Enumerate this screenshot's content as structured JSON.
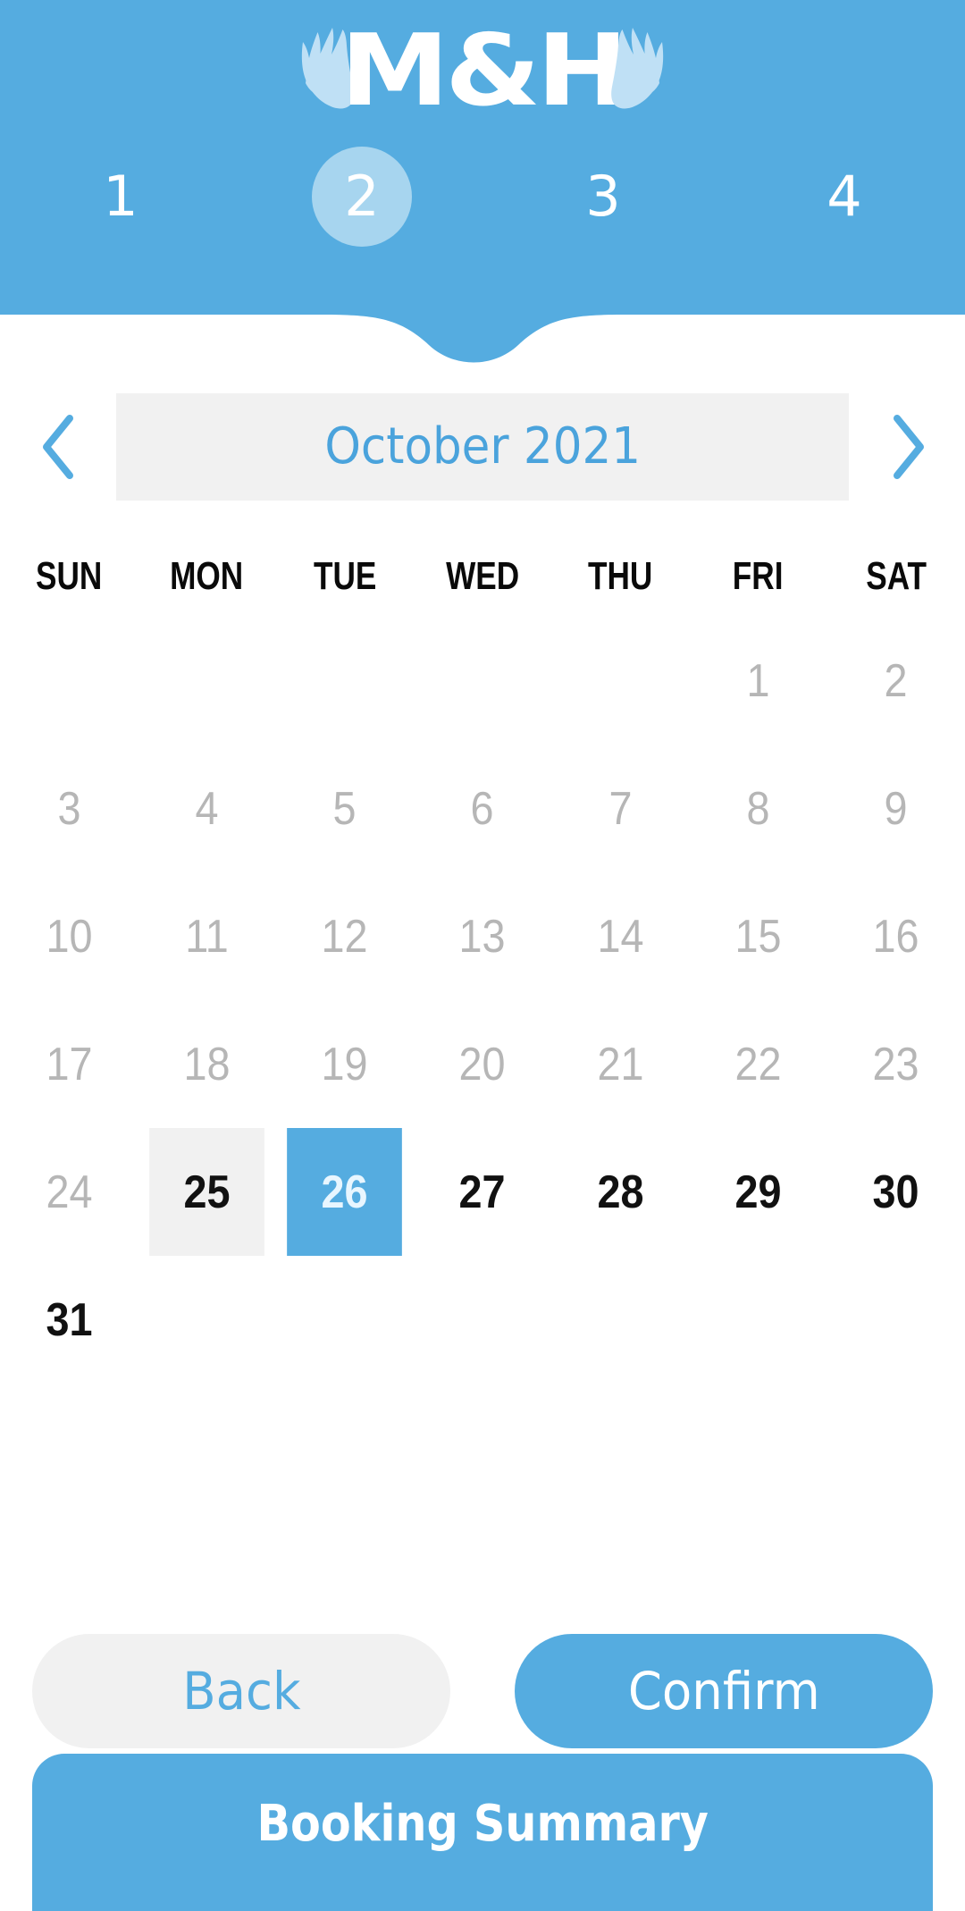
{
  "brand": {
    "name": "M&H",
    "left_wing_icon": "wing-icon",
    "right_wing_icon": "wing-icon",
    "header_color": "#55ace0",
    "accent_color": "#55ace0",
    "step_circle_color": "#a7d5ef"
  },
  "stepper": {
    "active_step": "2",
    "steps": [
      {
        "label": "1",
        "active": false
      },
      {
        "label": "2",
        "active": true
      },
      {
        "label": "3",
        "active": false
      },
      {
        "label": "4",
        "active": false
      }
    ]
  },
  "month_nav": {
    "prev_icon": "chevron-left-icon",
    "next_icon": "chevron-right-icon",
    "label": "October 2021"
  },
  "calendar": {
    "weekdays": [
      "SUN",
      "MON",
      "TUE",
      "WED",
      "THU",
      "FRI",
      "SAT"
    ],
    "selected_day": "26",
    "today": "25",
    "weeks": [
      [
        {
          "label": "",
          "state": "empty"
        },
        {
          "label": "",
          "state": "empty"
        },
        {
          "label": "",
          "state": "empty"
        },
        {
          "label": "",
          "state": "empty"
        },
        {
          "label": "",
          "state": "empty"
        },
        {
          "label": "1",
          "state": "past"
        },
        {
          "label": "2",
          "state": "past"
        }
      ],
      [
        {
          "label": "3",
          "state": "past"
        },
        {
          "label": "4",
          "state": "past"
        },
        {
          "label": "5",
          "state": "past"
        },
        {
          "label": "6",
          "state": "past"
        },
        {
          "label": "7",
          "state": "past"
        },
        {
          "label": "8",
          "state": "past"
        },
        {
          "label": "9",
          "state": "past"
        }
      ],
      [
        {
          "label": "10",
          "state": "past"
        },
        {
          "label": "11",
          "state": "past"
        },
        {
          "label": "12",
          "state": "past"
        },
        {
          "label": "13",
          "state": "past"
        },
        {
          "label": "14",
          "state": "past"
        },
        {
          "label": "15",
          "state": "past"
        },
        {
          "label": "16",
          "state": "past"
        }
      ],
      [
        {
          "label": "17",
          "state": "past"
        },
        {
          "label": "18",
          "state": "past"
        },
        {
          "label": "19",
          "state": "past"
        },
        {
          "label": "20",
          "state": "past"
        },
        {
          "label": "21",
          "state": "past"
        },
        {
          "label": "22",
          "state": "past"
        },
        {
          "label": "23",
          "state": "past"
        }
      ],
      [
        {
          "label": "24",
          "state": "past"
        },
        {
          "label": "25",
          "state": "today"
        },
        {
          "label": "26",
          "state": "selected"
        },
        {
          "label": "27",
          "state": "available"
        },
        {
          "label": "28",
          "state": "available"
        },
        {
          "label": "29",
          "state": "available"
        },
        {
          "label": "30",
          "state": "available"
        }
      ],
      [
        {
          "label": "31",
          "state": "available"
        },
        {
          "label": "",
          "state": "empty"
        },
        {
          "label": "",
          "state": "empty"
        },
        {
          "label": "",
          "state": "empty"
        },
        {
          "label": "",
          "state": "empty"
        },
        {
          "label": "",
          "state": "empty"
        },
        {
          "label": "",
          "state": "empty"
        }
      ]
    ]
  },
  "footer": {
    "back_label": "Back",
    "confirm_label": "Confirm",
    "summary_label": "Booking Summary"
  }
}
